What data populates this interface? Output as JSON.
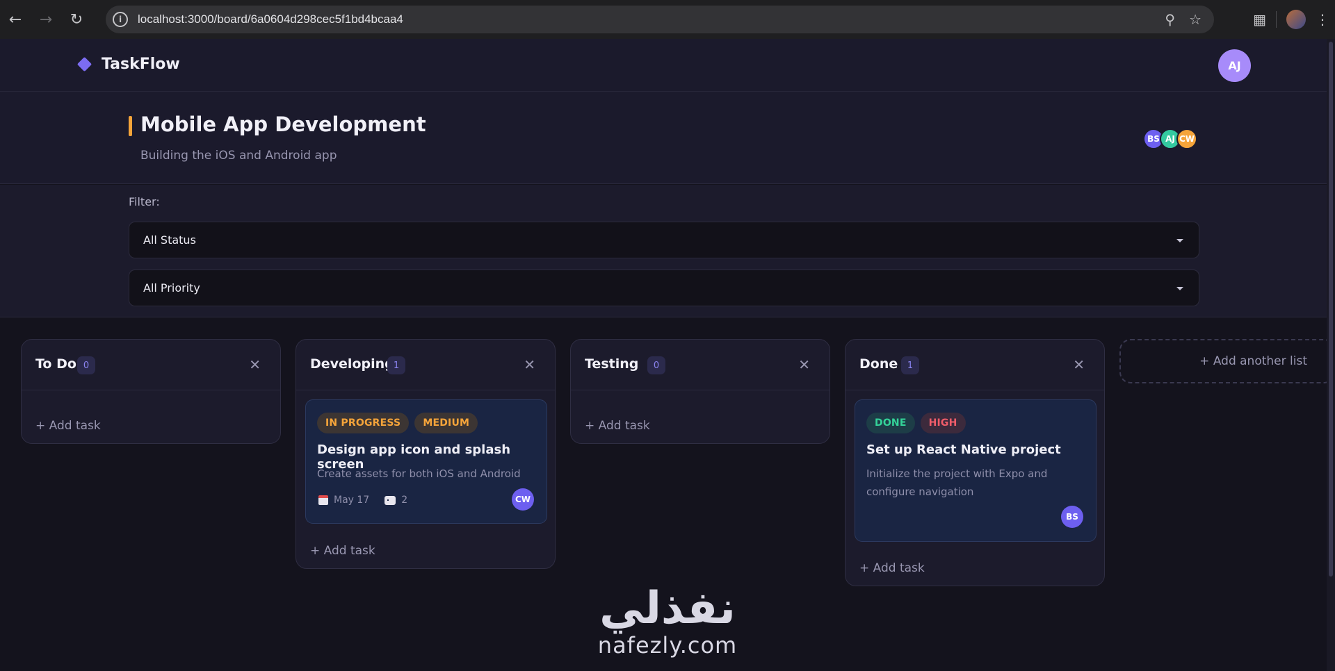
{
  "browser": {
    "url": "localhost:3000/board/6a0604d298cec5f1bd4bcaa4"
  },
  "app": {
    "name": "TaskFlow",
    "user_initials": "AJ"
  },
  "board": {
    "title": "Mobile App Development",
    "description": "Building the iOS and Android app",
    "members": [
      {
        "initials": "BS",
        "color": "#6d5ff0"
      },
      {
        "initials": "AJ",
        "color": "#34c9a0"
      },
      {
        "initials": "CW",
        "color": "#f5a43a"
      }
    ]
  },
  "filters": {
    "label": "Filter:",
    "status_value": "All Status",
    "priority_value": "All Priority"
  },
  "lists": [
    {
      "title": "To Do",
      "count": "0",
      "add_label": "+ Add task"
    },
    {
      "title": "Developing",
      "count": "1",
      "add_label": "+ Add task",
      "card": {
        "tags": [
          "IN PROGRESS",
          "MEDIUM"
        ],
        "title": "Design app icon and splash screen",
        "description": "Create assets for both iOS and Android",
        "due": "May 17",
        "comments": "2",
        "assignee": "CW"
      }
    },
    {
      "title": "Testing",
      "count": "0",
      "add_label": "+ Add task"
    },
    {
      "title": "Done",
      "count": "1",
      "add_label": "+ Add task",
      "card": {
        "tags": [
          "DONE",
          "HIGH"
        ],
        "title": "Set up React Native project",
        "description": "Initialize the project with Expo and configure navigation",
        "assignee": "BS"
      }
    }
  ],
  "add_list_label": "+ Add another list",
  "watermark": {
    "arabic": "نفذلي",
    "latin": "nafezly.com"
  }
}
